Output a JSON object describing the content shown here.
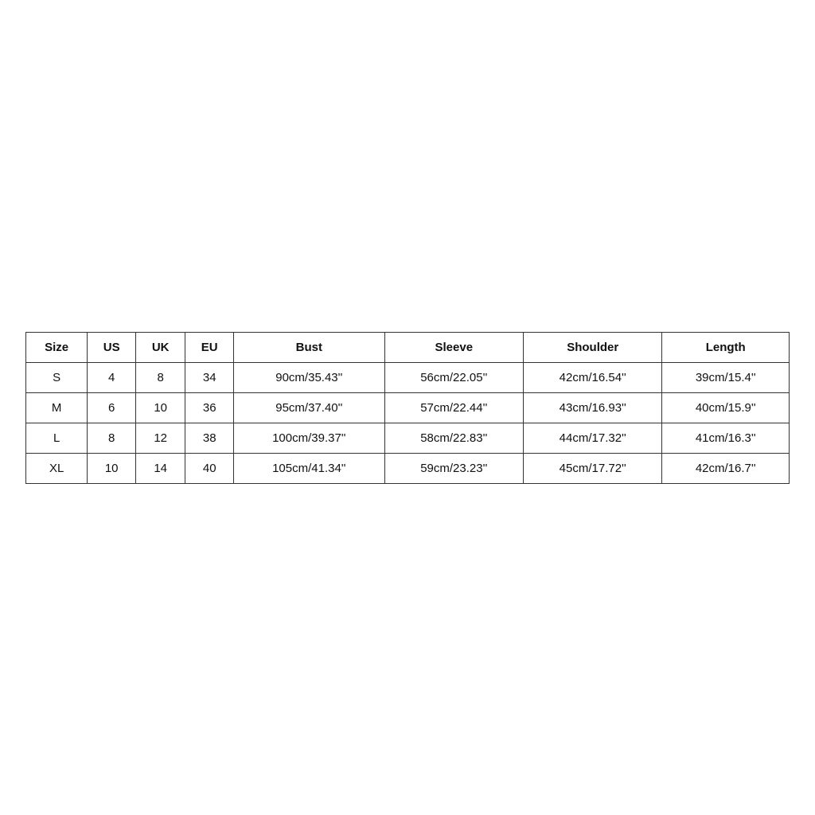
{
  "table": {
    "headers": [
      "Size",
      "US",
      "UK",
      "EU",
      "Bust",
      "Sleeve",
      "Shoulder",
      "Length"
    ],
    "rows": [
      [
        "S",
        "4",
        "8",
        "34",
        "90cm/35.43''",
        "56cm/22.05''",
        "42cm/16.54''",
        "39cm/15.4''"
      ],
      [
        "M",
        "6",
        "10",
        "36",
        "95cm/37.40''",
        "57cm/22.44''",
        "43cm/16.93''",
        "40cm/15.9''"
      ],
      [
        "L",
        "8",
        "12",
        "38",
        "100cm/39.37''",
        "58cm/22.83''",
        "44cm/17.32''",
        "41cm/16.3''"
      ],
      [
        "XL",
        "10",
        "14",
        "40",
        "105cm/41.34''",
        "59cm/23.23''",
        "45cm/17.72''",
        "42cm/16.7''"
      ]
    ]
  }
}
